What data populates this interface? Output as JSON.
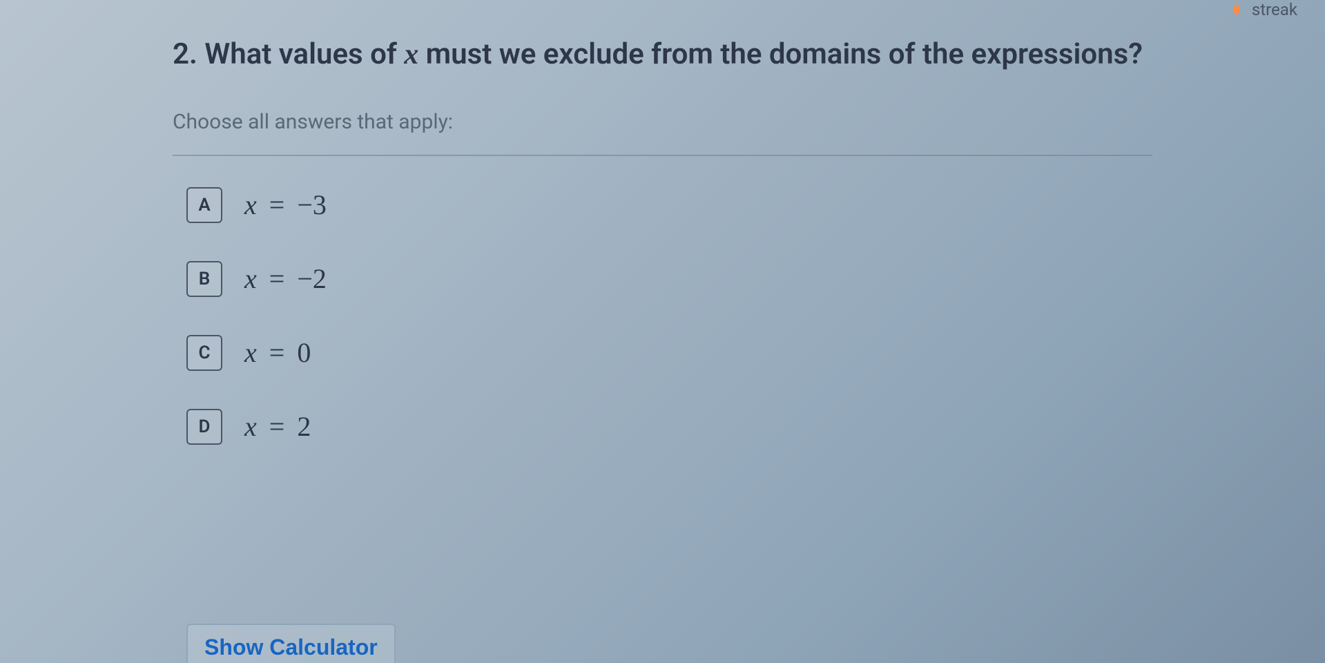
{
  "topbar": {
    "streak_label": "streak"
  },
  "question": {
    "number": "2.",
    "text_before": "What values of ",
    "variable": "x",
    "text_after": " must we exclude from the domains of the expressions?"
  },
  "instruction": "Choose all answers that apply:",
  "options": [
    {
      "letter": "A",
      "var": "x",
      "value": "−3"
    },
    {
      "letter": "B",
      "var": "x",
      "value": "−2"
    },
    {
      "letter": "C",
      "var": "x",
      "value": "0"
    },
    {
      "letter": "D",
      "var": "x",
      "value": "2"
    }
  ],
  "calculator_button": "Show Calculator"
}
